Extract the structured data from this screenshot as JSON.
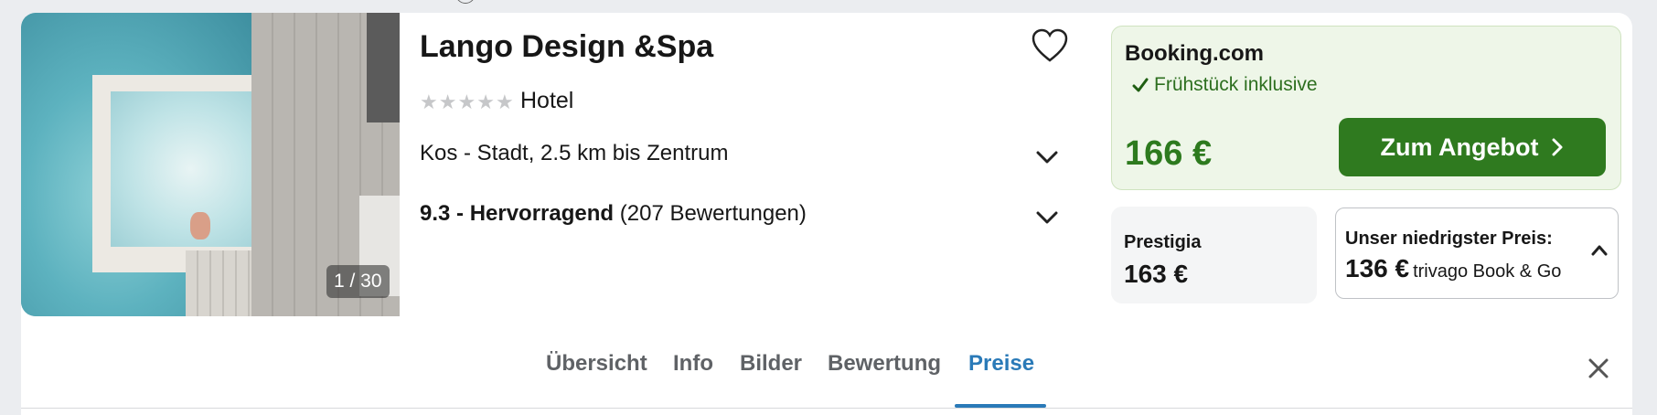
{
  "hotel": {
    "name": "Lango Design &Spa",
    "type": "Hotel",
    "stars": 5,
    "location": "Kos - Stadt, 2.5 km bis Zentrum",
    "rating_score": "9.3 - Hervorragend",
    "rating_count": "(207 Bewertungen)"
  },
  "gallery": {
    "counter": "1 / 30"
  },
  "offers": {
    "main": {
      "provider": "Booking.com",
      "feature": "Frühstück inklusive",
      "price": "166 €",
      "cta_label": "Zum Angebot"
    },
    "alt": {
      "provider": "Prestigia",
      "price": "163 €"
    },
    "lowest": {
      "label": "Unser niedrigster Preis:",
      "price": "136 €",
      "provider": "trivago Book & Go"
    }
  },
  "tabs": [
    {
      "label": "Übersicht"
    },
    {
      "label": "Info"
    },
    {
      "label": "Bilder"
    },
    {
      "label": "Bewertung"
    },
    {
      "label": "Preise",
      "active": true
    }
  ],
  "colors": {
    "accent_green": "#2f7a1f",
    "price_green": "#2d7a1e",
    "active_tab_blue": "#2a7ab8"
  },
  "icons": [
    "heart-icon",
    "chevron-down-icon",
    "check-icon",
    "chevron-right-icon",
    "chevron-up-icon",
    "close-icon",
    "star-icon"
  ]
}
